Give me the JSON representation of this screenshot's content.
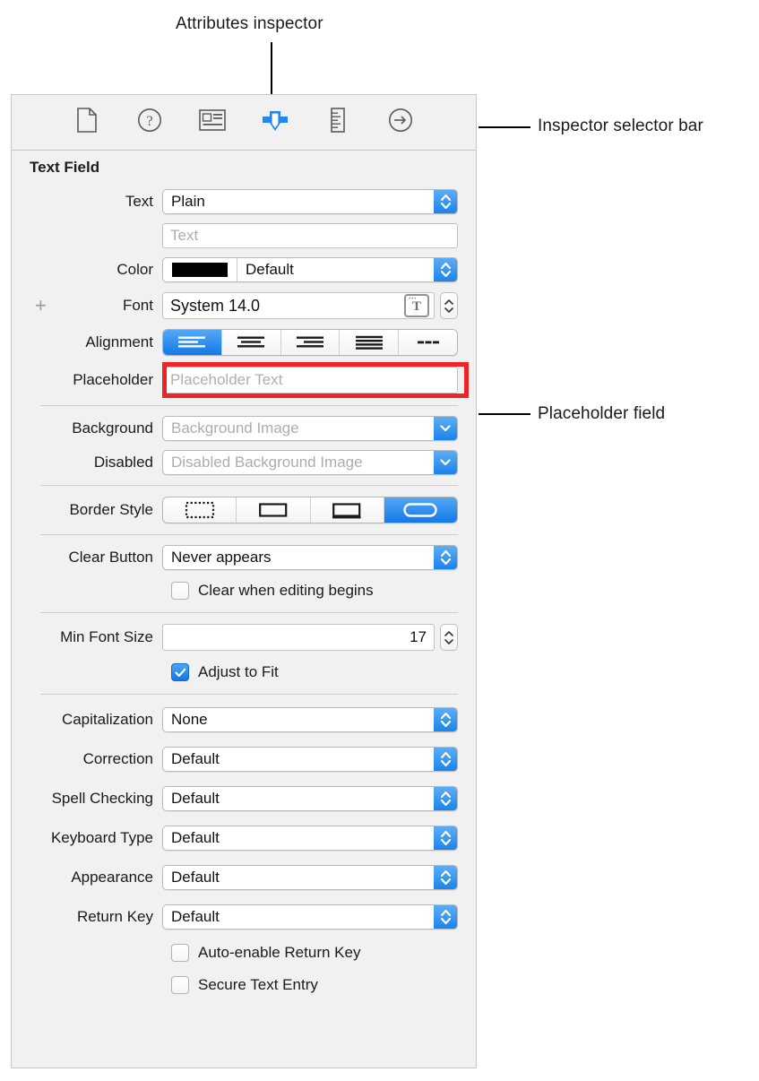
{
  "annotations": {
    "attributes_inspector": "Attributes inspector",
    "inspector_selector_bar": "Inspector selector bar",
    "placeholder_field": "Placeholder field"
  },
  "selector_bar": {
    "tabs": [
      {
        "name": "file-inspector",
        "icon": "document-icon",
        "selected": false
      },
      {
        "name": "quick-help-inspector",
        "icon": "question-circle-icon",
        "selected": false
      },
      {
        "name": "identity-inspector",
        "icon": "identity-card-icon",
        "selected": false
      },
      {
        "name": "attributes-inspector",
        "icon": "attributes-slider-icon",
        "selected": true
      },
      {
        "name": "size-inspector",
        "icon": "ruler-icon",
        "selected": false
      },
      {
        "name": "connections-inspector",
        "icon": "arrow-circle-icon",
        "selected": false
      }
    ]
  },
  "panel": {
    "section_title": "Text Field",
    "rows": {
      "text": {
        "label": "Text",
        "value": "Plain"
      },
      "text_content": {
        "placeholder": "Text",
        "value": ""
      },
      "color": {
        "label": "Color",
        "value": "Default",
        "swatch": "#000000"
      },
      "font": {
        "label": "Font",
        "value": "System 14.0",
        "add_glyph": "+"
      },
      "alignment": {
        "label": "Alignment",
        "options": [
          "left",
          "center",
          "right",
          "justified",
          "natural"
        ],
        "selected_index": 0
      },
      "placeholder": {
        "label": "Placeholder",
        "placeholder": "Placeholder Text",
        "value": ""
      },
      "background": {
        "label": "Background",
        "placeholder": "Background Image",
        "value": ""
      },
      "disabled": {
        "label": "Disabled",
        "placeholder": "Disabled Background Image",
        "value": ""
      },
      "border_style": {
        "label": "Border Style",
        "options": [
          "none-dotted",
          "line",
          "bezel",
          "rounded-rect"
        ],
        "selected_index": 3
      },
      "clear_button": {
        "label": "Clear Button",
        "value": "Never appears"
      },
      "clear_when_editing": {
        "label": "Clear when editing begins",
        "checked": false
      },
      "min_font_size": {
        "label": "Min Font Size",
        "value": "17"
      },
      "adjust_to_fit": {
        "label": "Adjust to Fit",
        "checked": true
      },
      "capitalization": {
        "label": "Capitalization",
        "value": "None"
      },
      "correction": {
        "label": "Correction",
        "value": "Default"
      },
      "spell_checking": {
        "label": "Spell Checking",
        "value": "Default"
      },
      "keyboard_type": {
        "label": "Keyboard Type",
        "value": "Default"
      },
      "appearance": {
        "label": "Appearance",
        "value": "Default"
      },
      "return_key": {
        "label": "Return Key",
        "value": "Default"
      },
      "auto_enable_return_key": {
        "label": "Auto-enable Return Key",
        "checked": false
      },
      "secure_text_entry": {
        "label": "Secure Text Entry",
        "checked": false
      }
    }
  },
  "colors": {
    "accent_blue": "#1a84ec",
    "highlight_red": "#ef2227",
    "panel_bg": "#f1f1f1"
  }
}
